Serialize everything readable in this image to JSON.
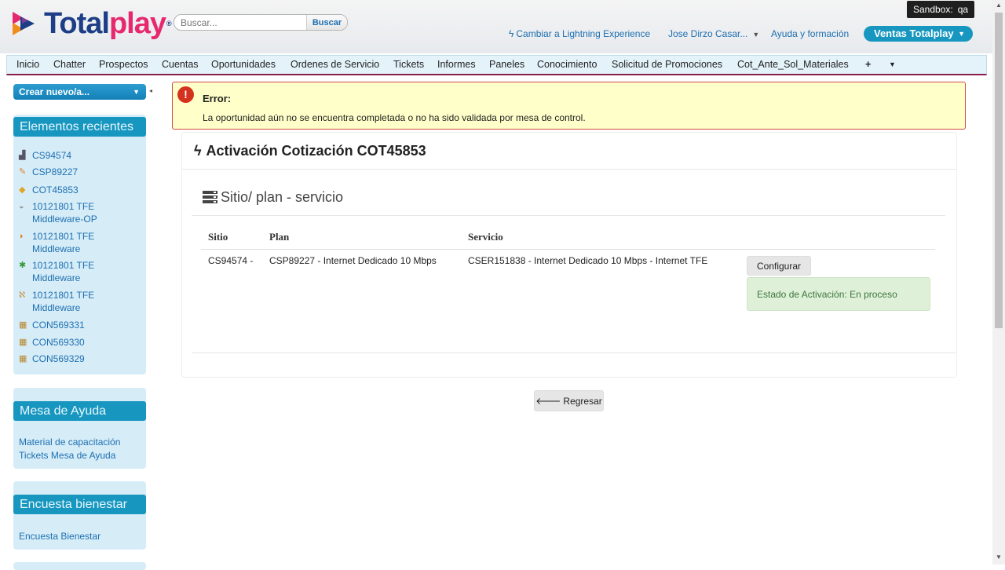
{
  "header": {
    "logo": {
      "part1": "Total",
      "part2": "play",
      "tm": "®"
    },
    "search": {
      "placeholder": "Buscar...",
      "button": "Buscar"
    },
    "sandbox": {
      "label": "Sandbox:",
      "value": "qa"
    },
    "lightning_link": "Cambiar a Lightning Experience",
    "user_menu": "Jose Dirzo Casar...",
    "help_link": "Ayuda y formación",
    "app_switcher": "Ventas Totalplay"
  },
  "tabs": [
    "Inicio",
    "Chatter",
    "Prospectos",
    "Cuentas",
    "Oportunidades",
    "Ordenes de Servicio",
    "Tickets",
    "Informes",
    "Paneles",
    "Conocimiento",
    "Solicitud de Promociones",
    "Cot_Ante_Sol_Materiales"
  ],
  "sidebar": {
    "create_button": "Crear nuevo/a...",
    "recent": {
      "title": "Elementos recientes",
      "items": [
        {
          "label": "CS94574",
          "icon": "site-icon"
        },
        {
          "label": "CSP89227",
          "icon": "pencil-icon"
        },
        {
          "label": "COT45853",
          "icon": "box-icon"
        },
        {
          "label": "10121801 TFE Middleware-OP",
          "icon": "disc-icon"
        },
        {
          "label": "10121801 TFE Middleware",
          "icon": "shield-icon"
        },
        {
          "label": "10121801 TFE Middleware",
          "icon": "star-icon"
        },
        {
          "label": "10121801 TFE Middleware",
          "icon": "card-icon"
        },
        {
          "label": "CON569331",
          "icon": "contract-icon"
        },
        {
          "label": "CON569330",
          "icon": "contract-icon"
        },
        {
          "label": "CON569329",
          "icon": "contract-icon"
        }
      ]
    },
    "help_desk": {
      "title": "Mesa de Ayuda",
      "links": [
        "Material de capacitación",
        "Tickets Mesa de Ayuda"
      ]
    },
    "survey": {
      "title": "Encuesta bienestar",
      "links": [
        "Encuesta Bienestar"
      ]
    }
  },
  "error": {
    "title": "Error:",
    "message": "La oportunidad aún no se encuentra completada o no ha sido validada por mesa de control."
  },
  "page": {
    "title": "Activación Cotización COT45853",
    "section_title": "Sitio/ plan - servicio",
    "table": {
      "headers": [
        "Sitio",
        "Plan",
        "Servicio"
      ],
      "row": {
        "sitio": "CS94574 -",
        "plan": "CSP89227 - Internet Dedicado 10 Mbps",
        "servicio": "CSER151838 - Internet Dedicado 10 Mbps - Internet TFE"
      }
    },
    "configure_button": "Configurar",
    "status": "Estado de Activación: En proceso",
    "back_button": "Regresar"
  },
  "colors": {
    "brand_blue": "#1d3e86",
    "brand_pink": "#e6296f",
    "accent": "#1797c0",
    "error_border": "#d04a4a"
  }
}
